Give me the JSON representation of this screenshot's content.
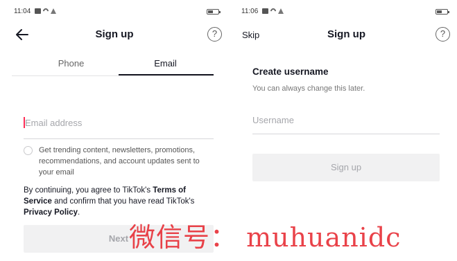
{
  "left_screen": {
    "status": {
      "time": "11:04"
    },
    "nav": {
      "title": "Sign up",
      "help_glyph": "?"
    },
    "tabs": [
      {
        "label": "Phone",
        "active": false
      },
      {
        "label": "Email",
        "active": true
      }
    ],
    "email_input": {
      "placeholder": "Email address",
      "value": ""
    },
    "consent": {
      "text": "Get trending content, newsletters, promotions, recommendations, and account updates sent to your email",
      "checked": false
    },
    "terms": {
      "prefix": "By continuing, you agree to TikTok's ",
      "terms_link": "Terms of Service",
      "middle": " and confirm that you have read TikTok's ",
      "privacy_link": "Privacy Policy",
      "suffix": "."
    },
    "next_button": {
      "label": "Next",
      "enabled": false
    }
  },
  "right_screen": {
    "status": {
      "time": "11:06"
    },
    "nav": {
      "skip_label": "Skip",
      "title": "Sign up",
      "help_glyph": "?"
    },
    "heading": "Create username",
    "subheading": "You can always change this later.",
    "username_input": {
      "placeholder": "Username",
      "value": ""
    },
    "signup_button": {
      "label": "Sign up",
      "enabled": false
    }
  },
  "watermark": {
    "text": "微信号： muhuanidc"
  },
  "colors": {
    "accent": "#fe2c55",
    "text": "#161823",
    "disabled_bg": "#f1f1f2",
    "disabled_text": "#a5a6ab",
    "watermark": "#e8333a"
  },
  "icons": {
    "back": "back-arrow-icon",
    "help": "help-circle-icon",
    "battery": "battery-icon",
    "wifi": "wifi-icon",
    "signal": "signal-icon",
    "message": "message-icon"
  }
}
